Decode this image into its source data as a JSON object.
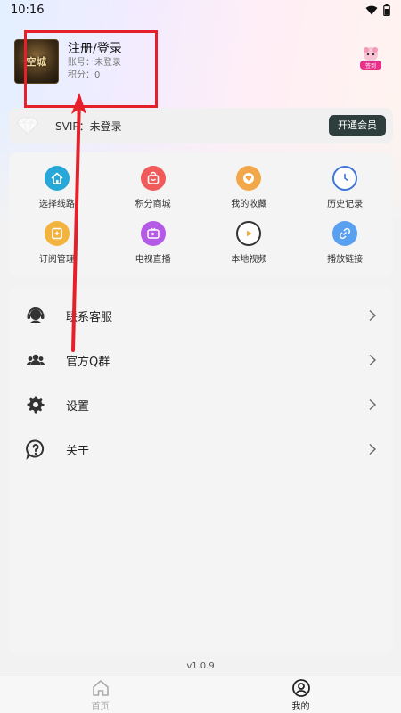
{
  "status_bar": {
    "time": "10:16",
    "wifi_icon": "wifi-icon",
    "battery_icon": "battery-icon"
  },
  "profile": {
    "avatar_text": "空城",
    "name": "注册/登录",
    "account_line": "账号：未登录",
    "points_line": "积分：0"
  },
  "corner_badge": {
    "icon": "mascot-badge-icon",
    "label": "签到"
  },
  "vip": {
    "label": "SVIP：未登录",
    "button": "开通会员",
    "icon": "diamond-icon"
  },
  "shortcuts": [
    {
      "label": "选择线路",
      "icon": "house-icon",
      "color": "#26a8d8"
    },
    {
      "label": "积分商城",
      "icon": "shopping-bag-icon",
      "color": "#f05a5a"
    },
    {
      "label": "我的收藏",
      "icon": "heart-icon",
      "color": "#f2a84a"
    },
    {
      "label": "历史记录",
      "icon": "clock-icon",
      "color": "#3f76d8"
    },
    {
      "label": "订阅管理",
      "icon": "bookmark-icon",
      "color": "#f2b43c"
    },
    {
      "label": "电视直播",
      "icon": "tv-icon",
      "color": "#b45ae6"
    },
    {
      "label": "本地视频",
      "icon": "play-icon",
      "color": "#f0b040"
    },
    {
      "label": "播放链接",
      "icon": "link-icon",
      "color": "#5aa0f0"
    }
  ],
  "menu": [
    {
      "label": "联系客服",
      "icon": "headset-icon"
    },
    {
      "label": "官方Q群",
      "icon": "group-icon"
    },
    {
      "label": "设置",
      "icon": "gear-icon"
    },
    {
      "label": "关于",
      "icon": "question-icon"
    }
  ],
  "version": "v1.0.9",
  "nav": {
    "home": "首页",
    "mine": "我的"
  }
}
